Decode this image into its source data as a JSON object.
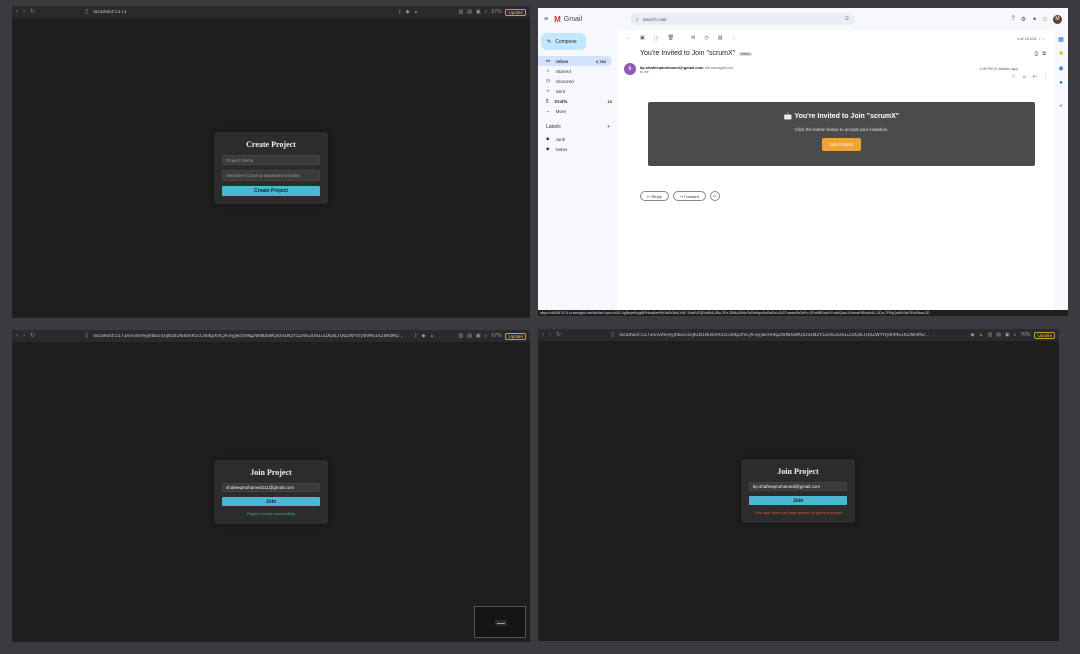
{
  "panels": {
    "top_left": {
      "url": "localhost:5173",
      "zoom": "67%",
      "update_label": "Update",
      "title": "Create Project",
      "name_placeholder": "Project Name",
      "members_placeholder": "Members (comma-separated emails)",
      "submit_label": "Create Project"
    },
    "bottom_left": {
      "url": "localhost:5173/invite/eyJhbGciOiJIUzI1NiIsInR5cCI6IkpXVCJ9.eyJwcm9qZWN0SWQiOiI1N2Y5ZmE2OS1iZDQxLTQ0ZWYtYjdhMS1hZWI4M2...",
      "zoom": "67%",
      "update_label": "Update",
      "title": "Join Project",
      "email_value": "shafeeqmohamed111@gmail.com",
      "submit_label": "Join",
      "status_message": "Project Joined successfully"
    },
    "bottom_right": {
      "url": "localhost:5173/invite/eyJhbGciOiJIUzI1NiIsInR5cCI6IkpXVCJ9.eyJwcm9qZWN0SWQiOiI1N2Y5ZmE2OS1iZDQxLTQ0ZWYtYjdhMS1hZWI4M2...",
      "zoom": "70%",
      "update_label": "Update",
      "title": "Join Project",
      "email_value": "kp.shafeeqmohamed@gmail.com",
      "submit_label": "Join",
      "status_message": "This user does not have access to join the project"
    }
  },
  "gmail": {
    "brand": "Gmail",
    "search_placeholder": "Search mail",
    "avatar_letter": "M",
    "compose_label": "Compose",
    "nav": [
      {
        "label": "Inbox",
        "count": "6,783"
      },
      {
        "label": "Starred",
        "count": ""
      },
      {
        "label": "Snoozed",
        "count": ""
      },
      {
        "label": "Sent",
        "count": ""
      },
      {
        "label": "Drafts",
        "count": "15"
      },
      {
        "label": "More",
        "count": ""
      }
    ],
    "labels_heading": "Labels",
    "labels": [
      "Junk",
      "Notes"
    ],
    "pagination": "1 of 10,031",
    "subject": "You're Invited to Join \"scrumX\"",
    "inbox_chip": "Inbox",
    "sender_avatar": "k",
    "sender_email": "kp.shafeeqmohamed@gmail.com",
    "sender_via": "via sendgrid.net",
    "to_line": "to me",
    "time": "4:09 PM (0 minutes ago)",
    "invite_heading": "You're Invited to Join \"scrumX\"",
    "invite_body": "Click the button below to accept your invitation.",
    "invite_button": "Join Project",
    "reply_label": "Reply",
    "forward_label": "Forward",
    "status_url": "https://u50087474.ct.sendgrid.net/ls/click?upn=u001.4gBsqe0vygBRHma8zeVtK4k8XWs1YAF-19a6VZQRaMb5-2Bu-2Fe-2B6U4DNeTeZbkhyvAkrBaDeL40GTmaxwSe2hPv=2FzhIBDnwXYcdtrQ4anXVumaFtRhakkU1-3Da-7FRyQaWHJtcPEdVBwa-3D"
  }
}
